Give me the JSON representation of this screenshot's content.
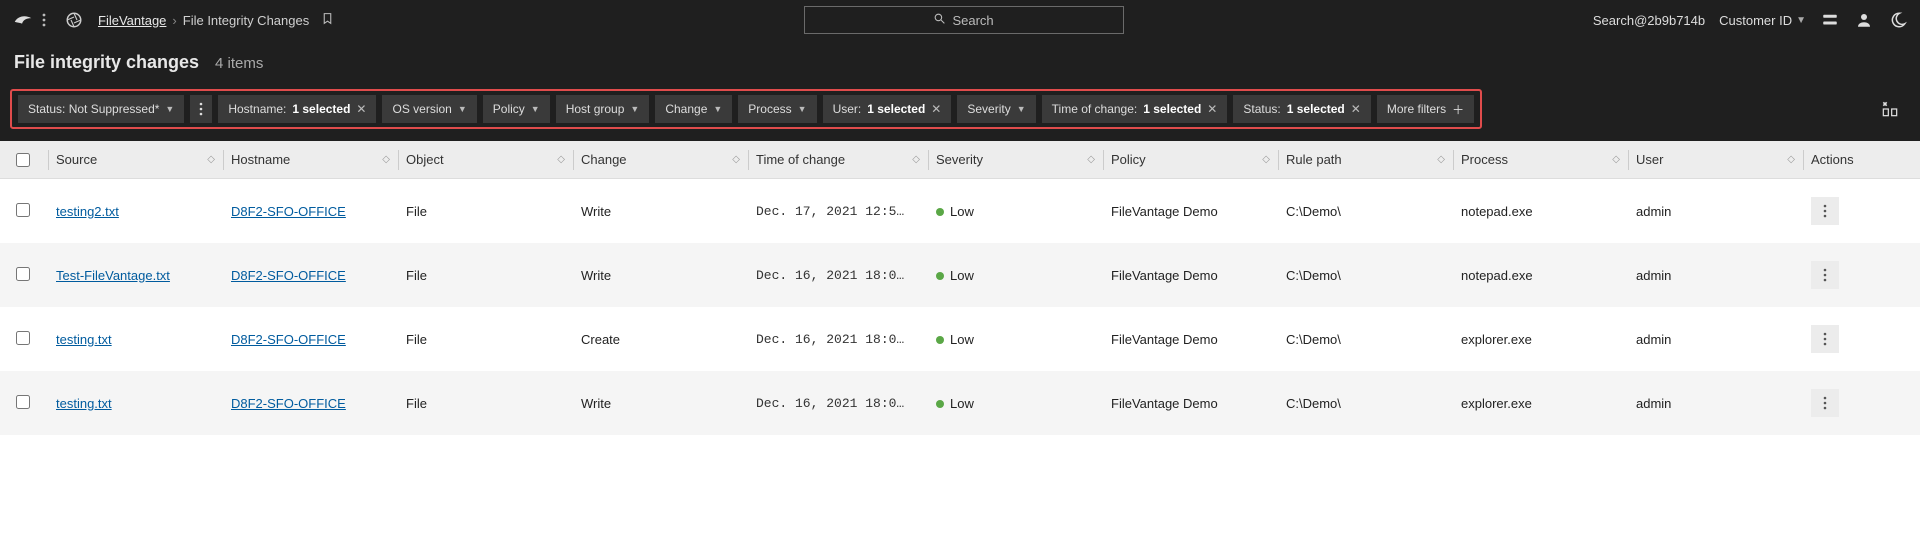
{
  "topbar": {
    "breadcrumb_root": "FileVantage",
    "breadcrumb_current": "File Integrity Changes",
    "search_placeholder": "Search",
    "account": "Search@2b9b714b",
    "customer_label": "Customer ID"
  },
  "title": {
    "heading": "File integrity changes",
    "count": "4 items"
  },
  "filters": {
    "main": {
      "label": "Status: Not Suppressed*"
    },
    "chips": [
      {
        "label": "Hostname:",
        "value": "1 selected",
        "close": true
      },
      {
        "label": "OS version",
        "chev": true
      },
      {
        "label": "Policy",
        "chev": true
      },
      {
        "label": "Host group",
        "chev": true
      },
      {
        "label": "Change",
        "chev": true
      },
      {
        "label": "Process",
        "chev": true
      },
      {
        "label": "User:",
        "value": "1 selected",
        "close": true
      },
      {
        "label": "Severity",
        "chev": true
      },
      {
        "label": "Time of change:",
        "value": "1 selected",
        "close": true
      },
      {
        "label": "Status:",
        "value": "1 selected",
        "close": true
      }
    ],
    "more": "More filters"
  },
  "columns": {
    "source": "Source",
    "hostname": "Hostname",
    "object": "Object",
    "change": "Change",
    "time": "Time of change",
    "severity": "Severity",
    "policy": "Policy",
    "rule": "Rule path",
    "process": "Process",
    "user": "User",
    "actions": "Actions"
  },
  "rows": [
    {
      "source": "testing2.txt",
      "hostname": "D8F2-SFO-OFFICE",
      "object": "File",
      "change": "Write",
      "time": "Dec. 17, 2021 12:5…",
      "severity": "Low",
      "policy": "FileVantage Demo",
      "rule": "C:\\Demo\\",
      "process": "notepad.exe",
      "user": "admin"
    },
    {
      "source": "Test-FileVantage.txt",
      "hostname": "D8F2-SFO-OFFICE",
      "object": "File",
      "change": "Write",
      "time": "Dec. 16, 2021 18:0…",
      "severity": "Low",
      "policy": "FileVantage Demo",
      "rule": "C:\\Demo\\",
      "process": "notepad.exe",
      "user": "admin"
    },
    {
      "source": "testing.txt",
      "hostname": "D8F2-SFO-OFFICE",
      "object": "File",
      "change": "Create",
      "time": "Dec. 16, 2021 18:0…",
      "severity": "Low",
      "policy": "FileVantage Demo",
      "rule": "C:\\Demo\\",
      "process": "explorer.exe",
      "user": "admin"
    },
    {
      "source": "testing.txt",
      "hostname": "D8F2-SFO-OFFICE",
      "object": "File",
      "change": "Write",
      "time": "Dec. 16, 2021 18:0…",
      "severity": "Low",
      "policy": "FileVantage Demo",
      "rule": "C:\\Demo\\",
      "process": "explorer.exe",
      "user": "admin"
    }
  ]
}
